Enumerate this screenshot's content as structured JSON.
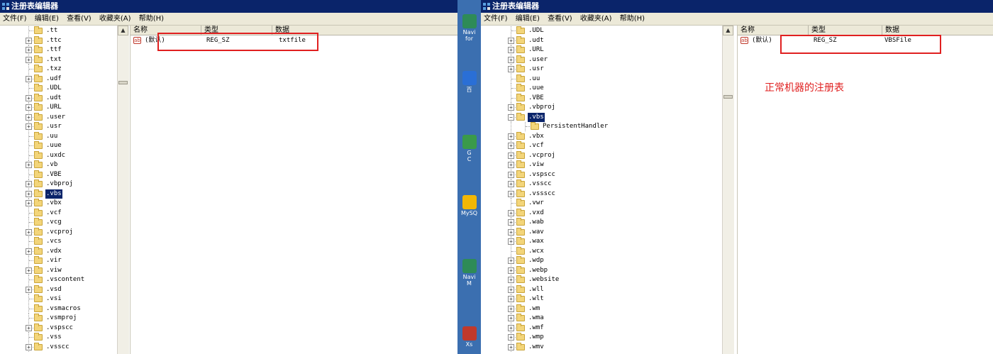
{
  "left_window": {
    "title": "注册表编辑器",
    "menu": [
      "文件(F)",
      "编辑(E)",
      "查看(V)",
      "收藏夹(A)",
      "帮助(H)"
    ],
    "tree_items": [
      {
        "label": ".tt",
        "expandable": false
      },
      {
        "label": ".ttc",
        "expandable": true
      },
      {
        "label": ".ttf",
        "expandable": true
      },
      {
        "label": ".txt",
        "expandable": true
      },
      {
        "label": ".txz",
        "expandable": false
      },
      {
        "label": ".udf",
        "expandable": true
      },
      {
        "label": ".UDL",
        "expandable": false
      },
      {
        "label": ".udt",
        "expandable": true
      },
      {
        "label": ".URL",
        "expandable": true
      },
      {
        "label": ".user",
        "expandable": true
      },
      {
        "label": ".usr",
        "expandable": true
      },
      {
        "label": ".uu",
        "expandable": false
      },
      {
        "label": ".uue",
        "expandable": false
      },
      {
        "label": ".uxdc",
        "expandable": false
      },
      {
        "label": ".vb",
        "expandable": true
      },
      {
        "label": ".VBE",
        "expandable": false
      },
      {
        "label": ".vbproj",
        "expandable": true
      },
      {
        "label": ".vbs",
        "expandable": true,
        "selected": true
      },
      {
        "label": ".vbx",
        "expandable": true
      },
      {
        "label": ".vcf",
        "expandable": false
      },
      {
        "label": ".vcg",
        "expandable": false
      },
      {
        "label": ".vcproj",
        "expandable": true
      },
      {
        "label": ".vcs",
        "expandable": false
      },
      {
        "label": ".vdx",
        "expandable": true
      },
      {
        "label": ".vir",
        "expandable": false
      },
      {
        "label": ".viw",
        "expandable": true
      },
      {
        "label": ".vscontent",
        "expandable": false
      },
      {
        "label": ".vsd",
        "expandable": true
      },
      {
        "label": ".vsi",
        "expandable": false
      },
      {
        "label": ".vsmacros",
        "expandable": false
      },
      {
        "label": ".vsmproj",
        "expandable": false
      },
      {
        "label": ".vspscc",
        "expandable": true
      },
      {
        "label": ".vss",
        "expandable": false
      },
      {
        "label": ".vsscc",
        "expandable": true
      }
    ],
    "columns": {
      "name": "名称",
      "type": "类型",
      "data": "数据"
    },
    "value": {
      "name": "(默认)",
      "type": "REG_SZ",
      "data": "txtfile"
    }
  },
  "right_window": {
    "title": "注册表编辑器",
    "menu": [
      "文件(F)",
      "编辑(E)",
      "查看(V)",
      "收藏夹(A)",
      "帮助(H)"
    ],
    "tree_items": [
      {
        "label": ".UDL",
        "expandable": false
      },
      {
        "label": ".udt",
        "expandable": true
      },
      {
        "label": ".URL",
        "expandable": true
      },
      {
        "label": ".user",
        "expandable": true
      },
      {
        "label": ".usr",
        "expandable": true
      },
      {
        "label": ".uu",
        "expandable": false
      },
      {
        "label": ".uue",
        "expandable": false
      },
      {
        "label": ".VBE",
        "expandable": false
      },
      {
        "label": ".vbproj",
        "expandable": true
      },
      {
        "label": ".vbs",
        "expandable": true,
        "expanded": true,
        "selected": true
      },
      {
        "label": "PersistentHandler",
        "expandable": false,
        "child": true
      },
      {
        "label": ".vbx",
        "expandable": true
      },
      {
        "label": ".vcf",
        "expandable": true
      },
      {
        "label": ".vcproj",
        "expandable": true
      },
      {
        "label": ".viw",
        "expandable": true
      },
      {
        "label": ".vspscc",
        "expandable": true
      },
      {
        "label": ".vsscc",
        "expandable": true
      },
      {
        "label": ".vssscc",
        "expandable": true
      },
      {
        "label": ".vwr",
        "expandable": false
      },
      {
        "label": ".vxd",
        "expandable": true
      },
      {
        "label": ".wab",
        "expandable": true
      },
      {
        "label": ".wav",
        "expandable": true
      },
      {
        "label": ".wax",
        "expandable": true
      },
      {
        "label": ".wcx",
        "expandable": false
      },
      {
        "label": ".wdp",
        "expandable": true
      },
      {
        "label": ".webp",
        "expandable": true
      },
      {
        "label": ".website",
        "expandable": true
      },
      {
        "label": ".wll",
        "expandable": true
      },
      {
        "label": ".wlt",
        "expandable": true
      },
      {
        "label": ".wm",
        "expandable": true
      },
      {
        "label": ".wma",
        "expandable": true
      },
      {
        "label": ".wmf",
        "expandable": true
      },
      {
        "label": ".wmp",
        "expandable": true
      },
      {
        "label": ".wmv",
        "expandable": true
      }
    ],
    "columns": {
      "name": "名称",
      "type": "类型",
      "data": "数据"
    },
    "value": {
      "name": "(默认)",
      "type": "REG_SZ",
      "data": "VBSFile"
    },
    "annotation": "正常机器的注册表"
  },
  "desktop_icons": [
    {
      "label": "Navi\nfor",
      "icon": "navicat-icon",
      "color": "#2e8b57"
    },
    {
      "label": "百",
      "icon": "browser-icon",
      "color": "#2a6fd6"
    },
    {
      "label": "G\nC",
      "icon": "chrome-icon",
      "color": "#3a9a4a"
    },
    {
      "label": "MySQ",
      "icon": "mysql-icon",
      "color": "#f2b705"
    },
    {
      "label": "Navi\nM",
      "icon": "navicat-icon",
      "color": "#2e8b57"
    },
    {
      "label": "Xs",
      "icon": "xshell-icon",
      "color": "#c0392b"
    }
  ],
  "colors": {
    "highlight": "#e02020",
    "selection": "#0a246a",
    "titlebar": "#0a246a"
  }
}
